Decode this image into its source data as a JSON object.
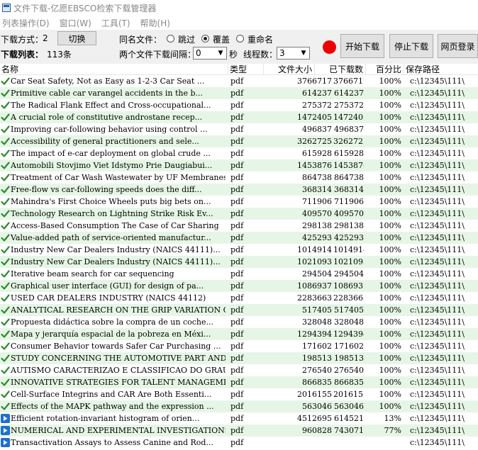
{
  "window": {
    "title": "文件下载-亿愿EBSCO检索下载管理器"
  },
  "menu": [
    "列表操作(D)",
    "窗口(W)",
    "工具(T)",
    "帮助(H)"
  ],
  "toolbar": {
    "mode_label": "下载方式：",
    "mode_value": "2",
    "switch_button": "切换",
    "list_label": "下载列表：",
    "list_count": "113条",
    "same_name_label": "同名文件：",
    "opt_skip": "跳过",
    "opt_overwrite": "覆盖",
    "opt_rename": "重命名",
    "selected_option": "overwrite",
    "interval_label": "两个文件下载间隔：",
    "interval_value": "0",
    "seconds_label": "秒",
    "threads_label": "线程数：",
    "threads_value": "3",
    "start_button": "开始下载",
    "stop_button": "停止下载",
    "login_button": "网页登录",
    "status_color": "#ee0000"
  },
  "columns": {
    "name": "名称",
    "type": "类型",
    "size": "文件大小",
    "done": "已下载数",
    "pct": "百分比",
    "path": "保存路径"
  },
  "rows": [
    {
      "status": "done",
      "name": "Car Seat Safety, Not as Easy as 1-2-3 Car Seat ...",
      "type": "pdf",
      "size": "3766717",
      "done": "3766717",
      "pct": "100%",
      "path": "c:\\12345\\111\\"
    },
    {
      "status": "done",
      "name": "Primitive cable car varangel accidents in the b...",
      "type": "pdf",
      "size": "614237",
      "done": "614237",
      "pct": "100%",
      "path": "c:\\12345\\111\\"
    },
    {
      "status": "done",
      "name": "The Radical Flank Effect and Cross-occupational...",
      "type": "pdf",
      "size": "275372",
      "done": "275372",
      "pct": "100%",
      "path": "c:\\12345\\111\\"
    },
    {
      "status": "done",
      "name": "A crucial role of constitutive androstane recep...",
      "type": "pdf",
      "size": "1472405",
      "done": "1472405",
      "pct": "100%",
      "path": "c:\\12345\\111\\"
    },
    {
      "status": "done",
      "name": "Improving car-following behavior using control ...",
      "type": "pdf",
      "size": "496837",
      "done": "496837",
      "pct": "100%",
      "path": "c:\\12345\\111\\"
    },
    {
      "status": "done",
      "name": "Accessibility of general practitioners and sele...",
      "type": "pdf",
      "size": "3262725",
      "done": "3262725",
      "pct": "100%",
      "path": "c:\\12345\\111\\"
    },
    {
      "status": "done",
      "name": "The impact of e-car deployment on global crude ...",
      "type": "pdf",
      "size": "615928",
      "done": "615928",
      "pct": "100%",
      "path": "c:\\12345\\111\\"
    },
    {
      "status": "done",
      "name": "Automobili Stovjimo Viet Idstymo Prie Daugiabui...",
      "type": "pdf",
      "size": "1453876",
      "done": "1453876",
      "pct": "100%",
      "path": "c:\\12345\\111\\"
    },
    {
      "status": "done",
      "name": "Treatment of Car Wash Wastewater by UF Membranes",
      "type": "pdf",
      "size": "864738",
      "done": "864738",
      "pct": "100%",
      "path": "c:\\12345\\111\\"
    },
    {
      "status": "done",
      "name": "Free-flow vs car-following speeds does the diff...",
      "type": "pdf",
      "size": "368314",
      "done": "368314",
      "pct": "100%",
      "path": "c:\\12345\\111\\"
    },
    {
      "status": "done",
      "name": "Mahindra's First Choice Wheels puts big bets on...",
      "type": "pdf",
      "size": "711906",
      "done": "711906",
      "pct": "100%",
      "path": "c:\\12345\\111\\"
    },
    {
      "status": "done",
      "name": "Technology Research on Lightning Strike Risk Ev...",
      "type": "pdf",
      "size": "409570",
      "done": "409570",
      "pct": "100%",
      "path": "c:\\12345\\111\\"
    },
    {
      "status": "done",
      "name": "Access-Based Consumption The Case of Car Sharing",
      "type": "pdf",
      "size": "298138",
      "done": "298138",
      "pct": "100%",
      "path": "c:\\12345\\111\\"
    },
    {
      "status": "done",
      "name": "Value-added path of service-oriented manufactur...",
      "type": "pdf",
      "size": "425293",
      "done": "425293",
      "pct": "100%",
      "path": "c:\\12345\\111\\"
    },
    {
      "status": "done",
      "name": "Industry New Car Dealers Industry (NAICS 44111)...",
      "type": "pdf",
      "size": "1014914",
      "done": "1014914",
      "pct": "100%",
      "path": "c:\\12345\\111\\"
    },
    {
      "status": "done",
      "name": "Industry New Car Dealers Industry (NAICS 44111)...",
      "type": "pdf",
      "size": "1021093",
      "done": "1021093",
      "pct": "100%",
      "path": "c:\\12345\\111\\"
    },
    {
      "status": "done",
      "name": "Iterative beam search for car sequencing",
      "type": "pdf",
      "size": "294504",
      "done": "294504",
      "pct": "100%",
      "path": "c:\\12345\\111\\"
    },
    {
      "status": "done",
      "name": "Graphical user interface (GUI) for design of pa...",
      "type": "pdf",
      "size": "1086937",
      "done": "1086937",
      "pct": "100%",
      "path": "c:\\12345\\111\\"
    },
    {
      "status": "done",
      "name": "USED CAR DEALERS INDUSTRY (NAICS 44112)",
      "type": "pdf",
      "size": "2283663",
      "done": "2283663",
      "pct": "100%",
      "path": "c:\\12345\\111\\"
    },
    {
      "status": "done",
      "name": "ANALYTICAL RESEARCH ON THE GRIP VARIATION OF TW...",
      "type": "pdf",
      "size": "517405",
      "done": "517405",
      "pct": "100%",
      "path": "c:\\12345\\111\\"
    },
    {
      "status": "done",
      "name": "Propuesta didáctica sobre la compra de un coche...",
      "type": "pdf",
      "size": "328048",
      "done": "328048",
      "pct": "100%",
      "path": "c:\\12345\\111\\"
    },
    {
      "status": "done",
      "name": "Mapa y jerarquía espacial de la pobreza en Méxi...",
      "type": "pdf",
      "size": "1294394",
      "done": "1294394",
      "pct": "100%",
      "path": "c:\\12345\\111\\"
    },
    {
      "status": "done",
      "name": "Consumer Behavior towards Safer Car Purchasing ...",
      "type": "pdf",
      "size": "171602",
      "done": "171602",
      "pct": "100%",
      "path": "c:\\12345\\111\\"
    },
    {
      "status": "done",
      "name": "STUDY CONCERNING THE AUTOMOTIVE PART AND ACCESS...",
      "type": "pdf",
      "size": "198513",
      "done": "198513",
      "pct": "100%",
      "path": "c:\\12345\\111\\"
    },
    {
      "status": "done",
      "name": "AUTISMO CARACTERIZAO E CLASSIFICAO DO GRAU DE S...",
      "type": "pdf",
      "size": "276540",
      "done": "276540",
      "pct": "100%",
      "path": "c:\\12345\\111\\"
    },
    {
      "status": "done",
      "name": "INNOVATIVE STRATEGIES FOR TALENT MANAGEMENT A C...",
      "type": "pdf",
      "size": "866835",
      "done": "866835",
      "pct": "100%",
      "path": "c:\\12345\\111\\"
    },
    {
      "status": "done",
      "name": "Cell-Surface Integrins and CAR Are Both Essenti...",
      "type": "pdf",
      "size": "2016155",
      "done": "2016155",
      "pct": "100%",
      "path": "c:\\12345\\111\\"
    },
    {
      "status": "done",
      "name": "Effects of the MAPK pathway and the expression ...",
      "type": "pdf",
      "size": "563046",
      "done": "563046",
      "pct": "100%",
      "path": "c:\\12345\\111\\"
    },
    {
      "status": "active",
      "name": "Efficient rotation-invariant histogram of orien...",
      "type": "pdf",
      "size": "4512695",
      "done": "614521",
      "pct": "13%",
      "path": "c:\\12345\\111\\"
    },
    {
      "status": "active",
      "name": "NUMERICAL AND EXPERIMENTAL INVESTIGATIONS OF DR...",
      "type": "pdf",
      "size": "960828",
      "done": "743071",
      "pct": "77%",
      "path": "c:\\12345\\111\\"
    },
    {
      "status": "active",
      "name": "Transactivation Assays to Assess Canine and Rod...",
      "type": "pdf",
      "size": "",
      "done": "",
      "pct": "",
      "path": "c:\\12345\\111\\"
    }
  ]
}
